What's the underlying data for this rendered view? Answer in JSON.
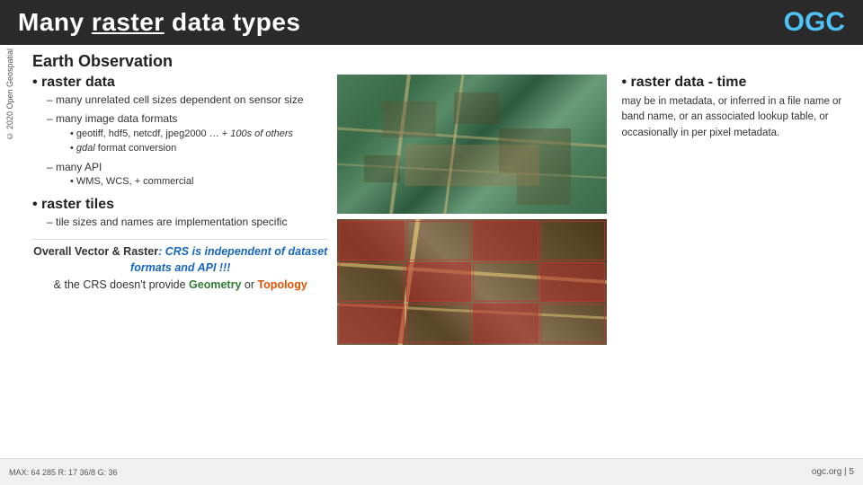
{
  "header": {
    "title_prefix": "Many ",
    "title_underline": "raster",
    "title_suffix": " data types",
    "ogc_label": "OGC"
  },
  "sidebar": {
    "text": "© 2020 Open Geospatial"
  },
  "section": {
    "title": "Earth Observation",
    "bullet1_label": "raster data",
    "sub1_label": "– many unrelated cell sizes dependent on sensor size",
    "sub2_label": "– many image data formats",
    "sub2_items": [
      "geotiff, hdf5, netcdf, jpeg2000 … + 100s of others",
      "gdal format conversion"
    ],
    "sub3_label": "– many API",
    "sub3_items": [
      "WMS, WCS, + commercial"
    ],
    "bullet2_label": "raster tiles",
    "sub4_label": "– tile sizes and names are implementation specific",
    "footer_bold": "Overall Vector & Raster",
    "footer_italic_blue": ": CRS is independent of dataset formats and API   !!!",
    "footer_line2_prefix": "& the CRS doesn't provide ",
    "footer_geometry": "Geometry",
    "footer_or": " or ",
    "footer_topology": "Topology",
    "raster_time_title": "raster data - time",
    "raster_time_desc": "may be in metadata, or inferred in a file name or band name, or an associated lookup table, or occasionally in per pixel metadata."
  },
  "bottom_bar": {
    "coords": "MAX: 64 285  R: 17  36/8  G: 36",
    "page": "ogc.org | 5"
  }
}
